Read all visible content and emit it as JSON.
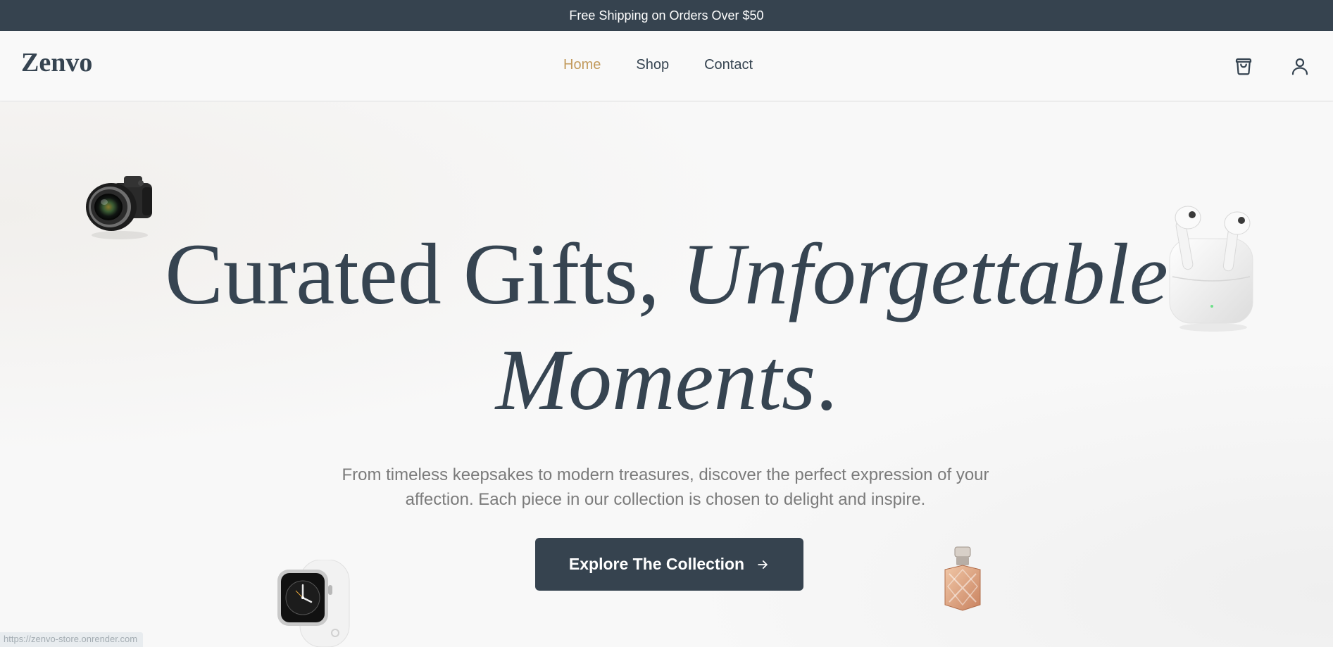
{
  "announcement": {
    "text": "Free Shipping on Orders Over $50"
  },
  "header": {
    "logo": "Zenvo",
    "nav": [
      {
        "label": "Home",
        "active": true
      },
      {
        "label": "Shop",
        "active": false
      },
      {
        "label": "Contact",
        "active": false
      }
    ],
    "icons": [
      "shopping-bag-icon",
      "user-icon"
    ]
  },
  "hero": {
    "headline_regular": "Curated Gifts, ",
    "headline_italic_1": "Unforgettable",
    "headline_italic_2": "Moments",
    "headline_end": ".",
    "subtext": "From timeless keepsakes to modern treasures, discover the perfect expression of your affection. Each piece in our collection is chosen to delight and inspire.",
    "cta_label": "Explore The Collection",
    "products": [
      "camera",
      "airpods",
      "smartwatch",
      "perfume"
    ]
  },
  "status_bar": {
    "url": "https://zenvo-store.onrender.com"
  },
  "colors": {
    "dark": "#36434f",
    "accent": "#c29a5c",
    "muted_text": "#7b7b7b",
    "background": "#f8f8f8"
  }
}
